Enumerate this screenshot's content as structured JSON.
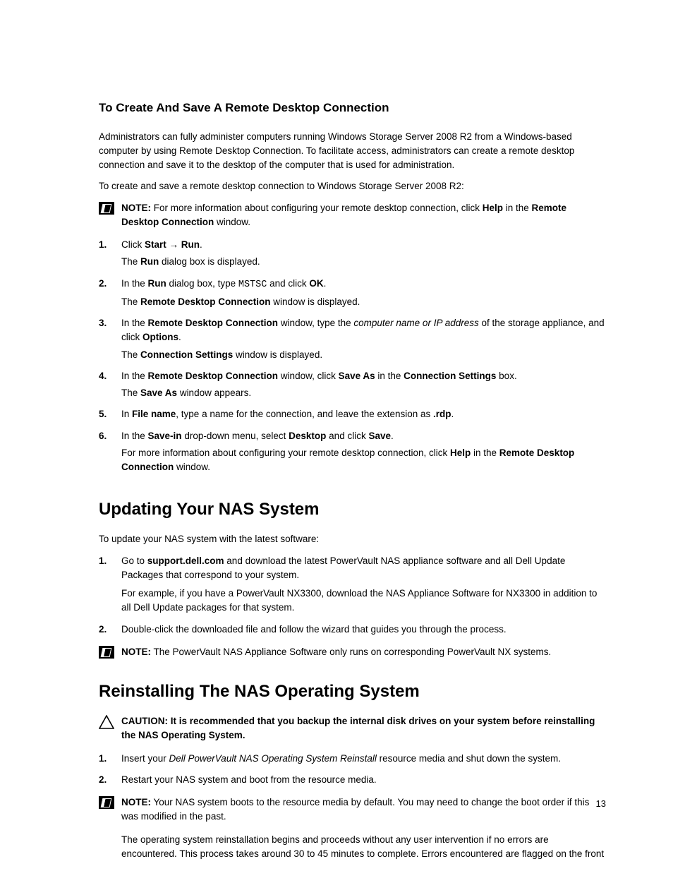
{
  "section1": {
    "heading": "To Create And Save A Remote Desktop Connection",
    "intro1": "Administrators can fully administer computers running Windows Storage Server 2008 R2 from a Windows-based computer by using Remote Desktop Connection. To facilitate access, administrators can create a remote desktop connection and save it to the desktop of the computer that is used for administration.",
    "intro2": "To create and save a remote desktop connection to Windows Storage Server 2008 R2:",
    "note": {
      "label": "NOTE:",
      "t1": " For more information about configuring your remote desktop connection, click ",
      "b1": "Help",
      "t2": " in the ",
      "b2": "Remote Desktop Connection",
      "t3": " window."
    },
    "steps": [
      {
        "num": "1.",
        "line1": {
          "t1": "Click ",
          "b1": "Start → Run",
          "t2": "."
        },
        "line2": {
          "t1": "The ",
          "b1": "Run",
          "t2": " dialog box is displayed."
        }
      },
      {
        "num": "2.",
        "line1": {
          "t1": "In the ",
          "b1": "Run",
          "t2": " dialog box, type ",
          "m1": "MSTSC",
          "t3": " and click ",
          "b2": "OK",
          "t4": "."
        },
        "line2": {
          "t1": "The ",
          "b1": "Remote Desktop Connection",
          "t2": " window is displayed."
        }
      },
      {
        "num": "3.",
        "line1": {
          "t1": "In the ",
          "b1": "Remote Desktop Connection",
          "t2": " window, type the ",
          "i1": "computer name or IP address",
          "t3": " of the storage appliance, and click ",
          "b2": "Options",
          "t4": "."
        },
        "line2": {
          "t1": "The ",
          "b1": "Connection Settings",
          "t2": " window is displayed."
        }
      },
      {
        "num": "4.",
        "line1": {
          "t1": "In the ",
          "b1": "Remote Desktop Connection",
          "t2": " window, click ",
          "b2": "Save As",
          "t3": " in the ",
          "b3": "Connection Settings",
          "t4": " box."
        },
        "line2": {
          "t1": "The ",
          "b1": "Save As",
          "t2": " window appears."
        }
      },
      {
        "num": "5.",
        "line1": {
          "t1": "In ",
          "b1": "File name",
          "t2": ", type a name for the connection, and leave the extension as ",
          "b2": ".rdp",
          "t3": "."
        }
      },
      {
        "num": "6.",
        "line1": {
          "t1": "In the ",
          "b1": "Save-in",
          "t2": " drop-down menu, select ",
          "b2": "Desktop",
          "t3": " and click ",
          "b3": "Save",
          "t4": "."
        },
        "line2": {
          "t1": "For more information about configuring your remote desktop connection, click ",
          "b1": "Help",
          "t2": " in the ",
          "b2": "Remote Desktop Connection",
          "t3": " window."
        }
      }
    ]
  },
  "section2": {
    "heading": "Updating Your NAS System",
    "intro": "To update your NAS system with the latest software:",
    "steps": [
      {
        "num": "1.",
        "line1": {
          "t1": "Go to ",
          "b1": "support.dell.com",
          "t2": " and download the latest PowerVault NAS appliance software and all Dell Update Packages that correspond to your system."
        },
        "line2": {
          "t1": "For example, if you have a PowerVault NX3300, download the NAS Appliance Software for NX3300 in addition to all Dell Update packages for that system."
        }
      },
      {
        "num": "2.",
        "line1": {
          "t1": "Double-click the downloaded file and follow the wizard that guides you through the process."
        }
      }
    ],
    "note": {
      "label": "NOTE:",
      "t1": " The PowerVault NAS Appliance Software only runs on corresponding PowerVault NX systems."
    }
  },
  "section3": {
    "heading": "Reinstalling The NAS Operating System",
    "caution": {
      "label": "CAUTION: It is recommended that you backup the internal disk drives on your system before reinstalling the NAS Operating System."
    },
    "steps": [
      {
        "num": "1.",
        "line1": {
          "t1": "Insert your ",
          "i1": "Dell PowerVault NAS Operating System Reinstall",
          "t2": " resource media and shut down the system."
        }
      },
      {
        "num": "2.",
        "line1": {
          "t1": "Restart your NAS system and boot from the resource media."
        }
      }
    ],
    "note": {
      "label": "NOTE:",
      "t1": " Your NAS system boots to the resource media by default. You may need to change the boot order if this was modified in the past."
    },
    "outro": "The operating system reinstallation begins and proceeds without any user intervention if no errors are encountered. This process takes around 30 to 45 minutes to complete. Errors encountered are flagged on the front"
  },
  "pageNumber": "13"
}
